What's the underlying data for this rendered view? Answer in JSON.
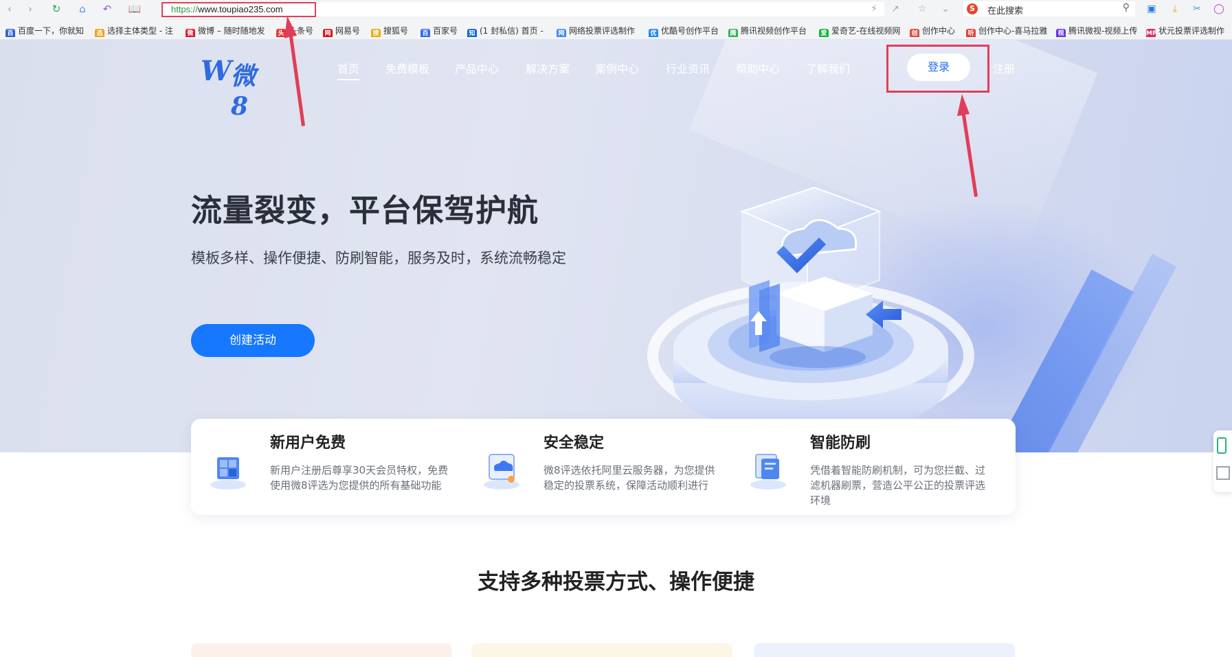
{
  "browser": {
    "url_scheme": "https://",
    "url_rest": "www.toupiao235.com",
    "search_placeholder": "在此搜索",
    "search_engine_letter": "S",
    "bookmarks": [
      {
        "label": "百度一下，你就知",
        "color": "#2f5fd8",
        "glyph": "百"
      },
      {
        "label": "选择主体类型 - 注",
        "color": "#f0a21a",
        "glyph": "选"
      },
      {
        "label": "微博 – 随时随地发",
        "color": "#e6162d",
        "glyph": "微"
      },
      {
        "label": "头条号",
        "color": "#e73431",
        "glyph": "头"
      },
      {
        "label": "网易号",
        "color": "#d8141a",
        "glyph": "网"
      },
      {
        "label": "搜狐号",
        "color": "#f2a800",
        "glyph": "搜"
      },
      {
        "label": "百家号",
        "color": "#2f6af0",
        "glyph": "百"
      },
      {
        "label": "(1 封私信) 首页 -",
        "color": "#0a66e4",
        "glyph": "知"
      },
      {
        "label": "网络投票评选制作",
        "color": "#3d8af5",
        "glyph": "网"
      },
      {
        "label": "优酷号创作平台",
        "color": "#1f8bf3",
        "glyph": "优"
      },
      {
        "label": "腾讯视频创作平台",
        "color": "#27b457",
        "glyph": "腾"
      },
      {
        "label": "爱奇艺-在线视频网",
        "color": "#11b83b",
        "glyph": "爱"
      },
      {
        "label": "创作中心",
        "color": "#e04a3a",
        "glyph": "创"
      },
      {
        "label": "创作中心-喜马拉雅",
        "color": "#e8403a",
        "glyph": "听"
      },
      {
        "label": "腾讯微视-视频上传",
        "color": "#6b32e8",
        "glyph": "视"
      },
      {
        "label": "状元投票评选制作",
        "color": "#d82b6c",
        "glyph": "MP"
      }
    ]
  },
  "site": {
    "logo_w": "W",
    "logo_text": "微8",
    "menu": [
      "首页",
      "免费模板",
      "产品中心",
      "解决方案",
      "案例中心",
      "行业资讯",
      "帮助中心",
      "了解我们"
    ],
    "login": "登录",
    "register": "注册",
    "headline": "流量裂变，平台保驾护航",
    "subline": "模板多样、操作便捷、防刷智能，服务及时，系统流畅稳定",
    "cta": "创建活动",
    "features": [
      {
        "title": "新用户免费",
        "desc": "新用户注册后尊享30天会员特权，免费使用微8评选为您提供的所有基础功能"
      },
      {
        "title": "安全稳定",
        "desc": "微8评选依托阿里云服务器，为您提供稳定的投票系统，保障活动顺利进行"
      },
      {
        "title": "智能防刷",
        "desc": "凭借着智能防刷机制，可为您拦截、过滤机器刷票，营造公平公正的投票评选环境"
      }
    ],
    "section_title": "支持多种投票方式、操作便捷"
  },
  "colors": {
    "primary": "#1677ff",
    "annotation": "#e23d57"
  }
}
